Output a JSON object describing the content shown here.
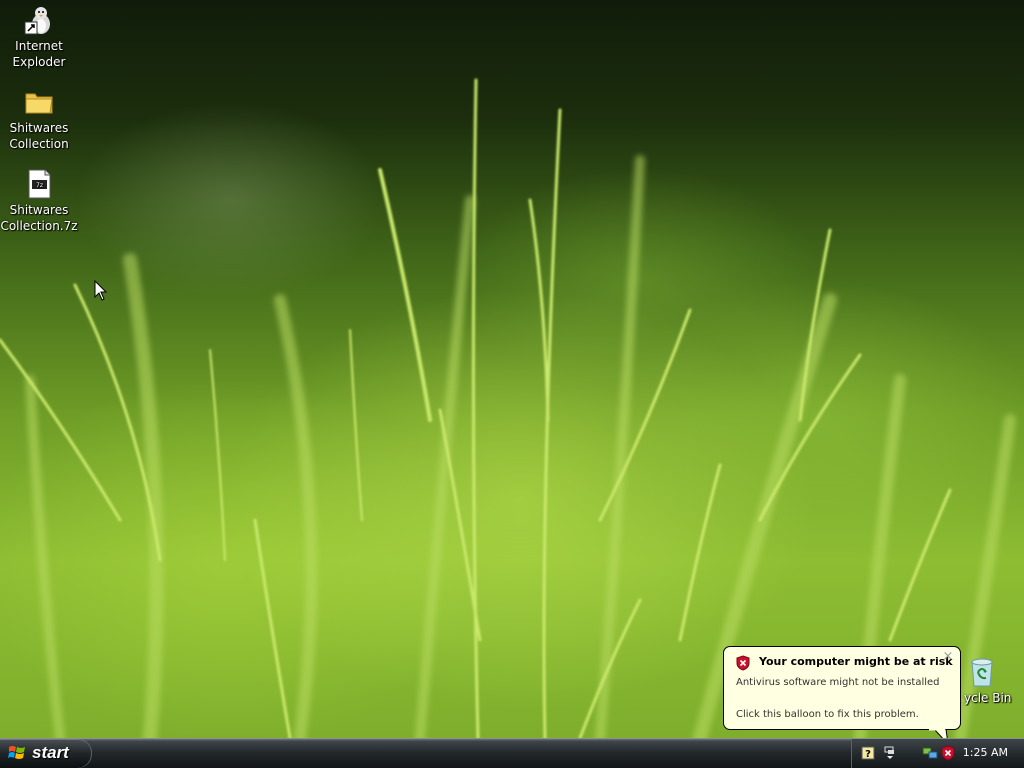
{
  "desktop": {
    "icons": [
      {
        "label_line1": "Internet",
        "label_line2": "Exploder",
        "icon": "ie-icon"
      },
      {
        "label_line1": "Shitwares",
        "label_line2": "Collection",
        "icon": "folder-icon"
      },
      {
        "label_line1": "Shitwares",
        "label_line2": "Collection.7z",
        "icon": "archive-icon"
      },
      {
        "label_line1": "ycle Bin",
        "icon": "recycle-bin-icon"
      }
    ]
  },
  "balloon": {
    "title": "Your computer might be at risk",
    "message1": "Antivirus software might not be installed",
    "message2": "Click this balloon to fix this problem.",
    "close_glyph": "×",
    "icon": "security-shield-icon"
  },
  "taskbar": {
    "start_label": "start",
    "clock": "1:25 AM",
    "tray_icons": [
      "help-icon",
      "safely-remove-hardware-icon",
      "network-icon",
      "security-alert-icon"
    ]
  },
  "colors": {
    "balloon_bg": "#ffffe1",
    "taskbar": "#24292c",
    "shield_red": "#c8102e"
  }
}
